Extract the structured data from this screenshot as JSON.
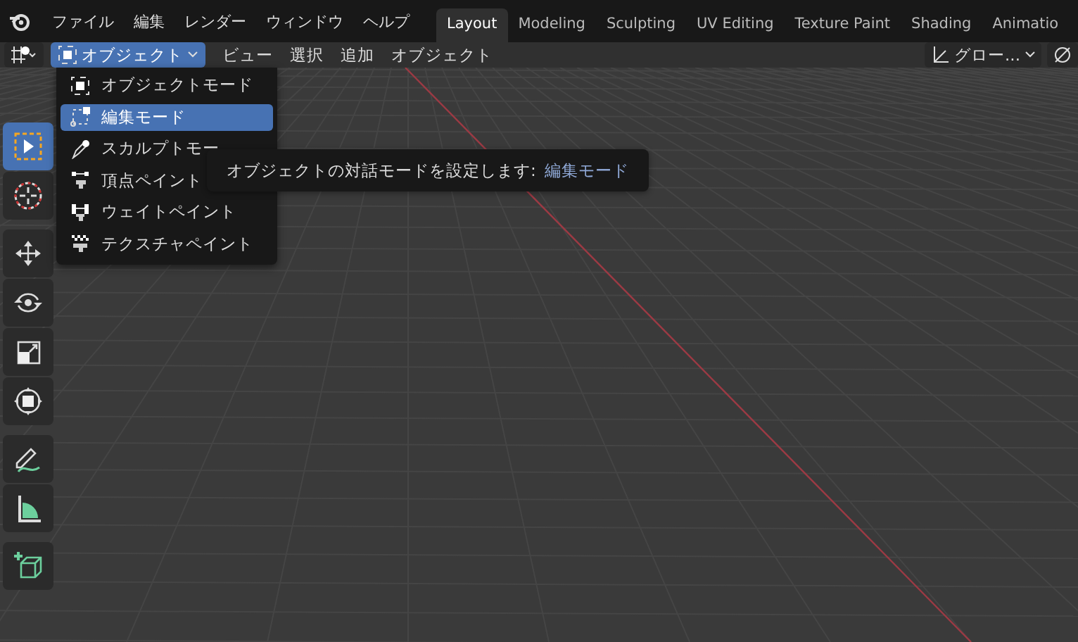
{
  "top_menu": {
    "items": [
      "ファイル",
      "編集",
      "レンダー",
      "ウィンドウ",
      "ヘルプ"
    ]
  },
  "workspace_tabs": [
    {
      "label": "Layout",
      "selected": true
    },
    {
      "label": "Modeling",
      "selected": false
    },
    {
      "label": "Sculpting",
      "selected": false
    },
    {
      "label": "UV Editing",
      "selected": false
    },
    {
      "label": "Texture Paint",
      "selected": false
    },
    {
      "label": "Shading",
      "selected": false
    },
    {
      "label": "Animatio",
      "selected": false
    }
  ],
  "header": {
    "mode_dropdown": "オブジェクト",
    "menus": [
      "ビュー",
      "選択",
      "追加",
      "オブジェクト"
    ],
    "orientation_dropdown": "グロー..."
  },
  "mode_menu": [
    {
      "kind": "object",
      "label": "オブジェクトモード",
      "selected": false
    },
    {
      "kind": "edit",
      "label": "編集モード",
      "selected": true
    },
    {
      "kind": "sculpt",
      "label": "スカルプトモー",
      "selected": false
    },
    {
      "kind": "vertex",
      "label": "頂点ペイント",
      "selected": false
    },
    {
      "kind": "weight",
      "label": "ウェイトペイント",
      "selected": false
    },
    {
      "kind": "texture",
      "label": "テクスチャペイント",
      "selected": false
    }
  ],
  "tooltip": {
    "text": "オブジェクトの対話モードを設定します:",
    "value": "編集モード"
  },
  "tools": [
    {
      "kind": "select",
      "selected": true
    },
    {
      "kind": "cursor",
      "selected": false
    },
    {
      "kind": "move",
      "selected": false
    },
    {
      "kind": "rotate",
      "selected": false
    },
    {
      "kind": "scale",
      "selected": false
    },
    {
      "kind": "transform",
      "selected": false
    },
    {
      "kind": "annotate",
      "selected": false
    },
    {
      "kind": "measure",
      "selected": false
    },
    {
      "kind": "add-cube",
      "selected": false
    }
  ]
}
